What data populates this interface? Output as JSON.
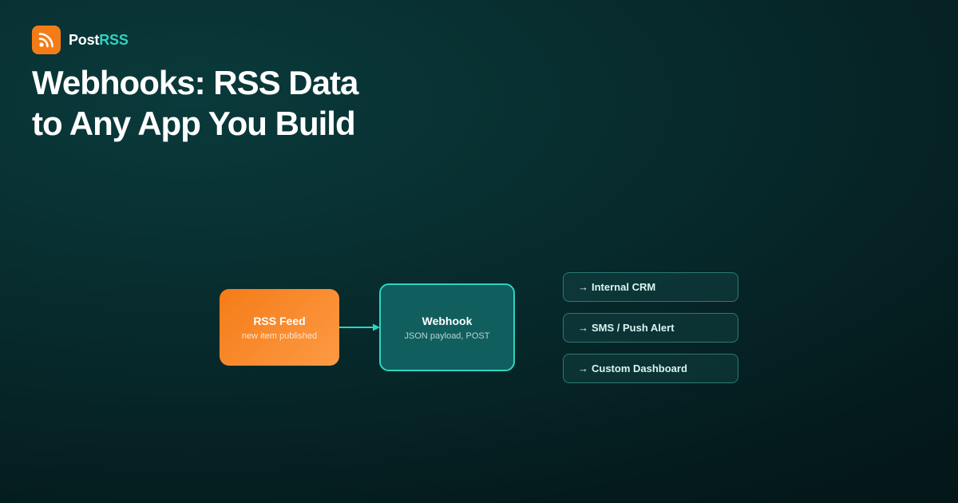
{
  "brand": {
    "name_part1": "Post",
    "name_part2": "RSS",
    "logo_icon": "rss-icon",
    "logo_color": "#f47c17",
    "accent_color": "#2dd4bf"
  },
  "title": {
    "line1": "Webhooks: RSS Data",
    "line2": "to Any App You Build"
  },
  "flow": {
    "source": {
      "title": "RSS Feed",
      "subtitle": "new item published"
    },
    "hub": {
      "title": "Webhook",
      "subtitle": "JSON payload, POST"
    },
    "destinations": [
      {
        "arrow": "→",
        "label": "Internal CRM"
      },
      {
        "arrow": "→",
        "label": "SMS / Push Alert"
      },
      {
        "arrow": "→",
        "label": "Custom Dashboard"
      }
    ]
  }
}
